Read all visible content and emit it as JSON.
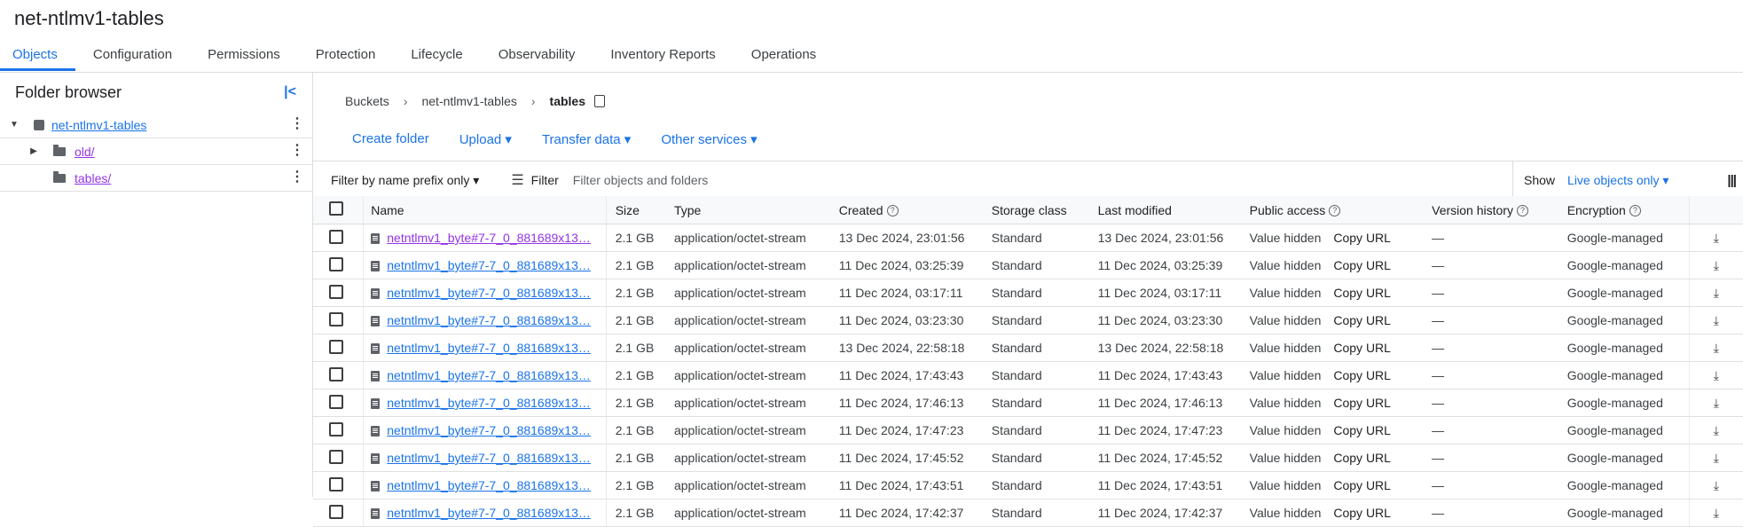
{
  "title": "net-ntlmv1-tables",
  "tabs": [
    "Objects",
    "Configuration",
    "Permissions",
    "Protection",
    "Lifecycle",
    "Observability",
    "Inventory Reports",
    "Operations"
  ],
  "sidebar": {
    "title": "Folder browser",
    "collapse_icon": "collapse-left-icon",
    "tree": [
      {
        "label": "net-ntlmv1-tables",
        "type": "bucket",
        "expanded": true
      },
      {
        "label": "old/",
        "type": "folder",
        "expanded": false
      },
      {
        "label": "tables/",
        "type": "folder",
        "expanded": false
      }
    ]
  },
  "breadcrumb": {
    "root": "Buckets",
    "bucket": "net-ntlmv1-tables",
    "current": "tables"
  },
  "actions": {
    "create": "Create folder",
    "upload": "Upload ▾",
    "transfer": "Transfer data ▾",
    "other": "Other services ▾"
  },
  "filterbar": {
    "prefix": "Filter by name prefix only ▾",
    "filter_label": "Filter",
    "placeholder": "Filter objects and folders",
    "show_label": "Show",
    "show_value": "Live objects only ▾"
  },
  "table": {
    "headers": {
      "name": "Name",
      "size": "Size",
      "type": "Type",
      "created": "Created",
      "storage": "Storage class",
      "modified": "Last modified",
      "public": "Public access",
      "version": "Version history",
      "encryption": "Encryption"
    },
    "rows": [
      {
        "name": "netntlmv1_byte#7-7_0_881689x13…",
        "size": "2.1 GB",
        "type": "application/octet-stream",
        "created": "13 Dec 2024, 23:01:56",
        "storage": "Standard",
        "modified": "13 Dec 2024, 23:01:56",
        "public": "Value hidden",
        "copy": "Copy URL",
        "version": "—",
        "encryption": "Google-managed"
      },
      {
        "name": "netntlmv1_byte#7-7_0_881689x13…",
        "size": "2.1 GB",
        "type": "application/octet-stream",
        "created": "11 Dec 2024, 03:25:39",
        "storage": "Standard",
        "modified": "11 Dec 2024, 03:25:39",
        "public": "Value hidden",
        "copy": "Copy URL",
        "version": "—",
        "encryption": "Google-managed"
      },
      {
        "name": "netntlmv1_byte#7-7_0_881689x13…",
        "size": "2.1 GB",
        "type": "application/octet-stream",
        "created": "11 Dec 2024, 03:17:11",
        "storage": "Standard",
        "modified": "11 Dec 2024, 03:17:11",
        "public": "Value hidden",
        "copy": "Copy URL",
        "version": "—",
        "encryption": "Google-managed"
      },
      {
        "name": "netntlmv1_byte#7-7_0_881689x13…",
        "size": "2.1 GB",
        "type": "application/octet-stream",
        "created": "11 Dec 2024, 03:23:30",
        "storage": "Standard",
        "modified": "11 Dec 2024, 03:23:30",
        "public": "Value hidden",
        "copy": "Copy URL",
        "version": "—",
        "encryption": "Google-managed"
      },
      {
        "name": "netntlmv1_byte#7-7_0_881689x13…",
        "size": "2.1 GB",
        "type": "application/octet-stream",
        "created": "13 Dec 2024, 22:58:18",
        "storage": "Standard",
        "modified": "13 Dec 2024, 22:58:18",
        "public": "Value hidden",
        "copy": "Copy URL",
        "version": "—",
        "encryption": "Google-managed"
      },
      {
        "name": "netntlmv1_byte#7-7_0_881689x13…",
        "size": "2.1 GB",
        "type": "application/octet-stream",
        "created": "11 Dec 2024, 17:43:43",
        "storage": "Standard",
        "modified": "11 Dec 2024, 17:43:43",
        "public": "Value hidden",
        "copy": "Copy URL",
        "version": "—",
        "encryption": "Google-managed"
      },
      {
        "name": "netntlmv1_byte#7-7_0_881689x13…",
        "size": "2.1 GB",
        "type": "application/octet-stream",
        "created": "11 Dec 2024, 17:46:13",
        "storage": "Standard",
        "modified": "11 Dec 2024, 17:46:13",
        "public": "Value hidden",
        "copy": "Copy URL",
        "version": "—",
        "encryption": "Google-managed"
      },
      {
        "name": "netntlmv1_byte#7-7_0_881689x13…",
        "size": "2.1 GB",
        "type": "application/octet-stream",
        "created": "11 Dec 2024, 17:47:23",
        "storage": "Standard",
        "modified": "11 Dec 2024, 17:47:23",
        "public": "Value hidden",
        "copy": "Copy URL",
        "version": "—",
        "encryption": "Google-managed"
      },
      {
        "name": "netntlmv1_byte#7-7_0_881689x13…",
        "size": "2.1 GB",
        "type": "application/octet-stream",
        "created": "11 Dec 2024, 17:45:52",
        "storage": "Standard",
        "modified": "11 Dec 2024, 17:45:52",
        "public": "Value hidden",
        "copy": "Copy URL",
        "version": "—",
        "encryption": "Google-managed"
      },
      {
        "name": "netntlmv1_byte#7-7_0_881689x13…",
        "size": "2.1 GB",
        "type": "application/octet-stream",
        "created": "11 Dec 2024, 17:43:51",
        "storage": "Standard",
        "modified": "11 Dec 2024, 17:43:51",
        "public": "Value hidden",
        "copy": "Copy URL",
        "version": "—",
        "encryption": "Google-managed"
      },
      {
        "name": "netntlmv1_byte#7-7_0_881689x13…",
        "size": "2.1 GB",
        "type": "application/octet-stream",
        "created": "11 Dec 2024, 17:42:37",
        "storage": "Standard",
        "modified": "11 Dec 2024, 17:42:37",
        "public": "Value hidden",
        "copy": "Copy URL",
        "version": "—",
        "encryption": "Google-managed"
      }
    ]
  }
}
